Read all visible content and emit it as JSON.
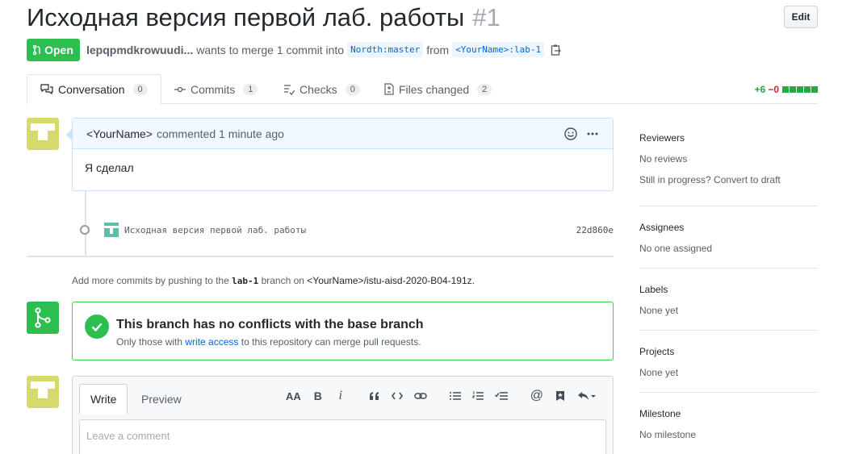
{
  "pr": {
    "title": "Исходная версия первой лаб. работы",
    "number": "#1",
    "edit_label": "Edit",
    "state": "Open",
    "author": "lepqpmdkrowuudi...",
    "action_text": "wants to merge 1 commit into",
    "base_branch": "Nordth:master",
    "from_text": "from",
    "head_branch": "<YourName>:lab-1"
  },
  "tabs": [
    {
      "label": "Conversation",
      "count": "0",
      "icon": "conversation-icon"
    },
    {
      "label": "Commits",
      "count": "1",
      "icon": "commit-icon"
    },
    {
      "label": "Checks",
      "count": "0",
      "icon": "checks-icon"
    },
    {
      "label": "Files changed",
      "count": "2",
      "icon": "file-diff-icon"
    }
  ],
  "diffstat": {
    "additions": "+6",
    "deletions": "−0",
    "colors": {
      "add": "#28a745",
      "del": "#cb2431"
    }
  },
  "comment": {
    "author": "<YourName>",
    "meta": "commented 1 minute ago",
    "body": "Я сделал"
  },
  "commit": {
    "message": "Исходная версия первой лаб. работы",
    "sha": "22d860e"
  },
  "hint": {
    "prefix": "Add more commits by pushing to the",
    "branch": "lab-1",
    "mid": "branch on",
    "repo": "<YourName>/istu-aisd-2020-B04-191z."
  },
  "merge": {
    "title": "This branch has no conflicts with the base branch",
    "sub_prefix": "Only those with",
    "sub_link": "write access",
    "sub_suffix": "to this repository can merge pull requests."
  },
  "editor": {
    "write_tab": "Write",
    "preview_tab": "Preview",
    "placeholder": "Leave a comment",
    "toolbar": {
      "heading": "AA",
      "bold": "B",
      "italic": "i"
    }
  },
  "sidebar": {
    "reviewers": {
      "title": "Reviewers",
      "value": "No reviews",
      "extra": "Still in progress? Convert to draft"
    },
    "assignees": {
      "title": "Assignees",
      "value": "No one assigned"
    },
    "labels": {
      "title": "Labels",
      "value": "None yet"
    },
    "projects": {
      "title": "Projects",
      "value": "None yet"
    },
    "milestone": {
      "title": "Milestone",
      "value": "No milestone"
    }
  },
  "colors": {
    "accent": "#0366d6",
    "success": "#2cbe4e",
    "avatar": "#d6da6e"
  }
}
